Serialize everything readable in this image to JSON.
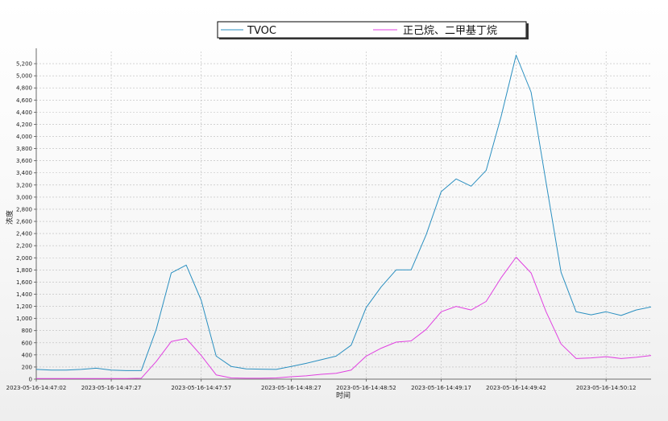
{
  "chart_data": {
    "type": "line",
    "xlabel": "时间",
    "ylabel": "浓度",
    "ylim": [
      0,
      5400
    ],
    "y_ticks": [
      0,
      200,
      400,
      600,
      800,
      1000,
      1200,
      1400,
      1600,
      1800,
      2000,
      2200,
      2400,
      2600,
      2800,
      3000,
      3200,
      3400,
      3600,
      3800,
      4000,
      4200,
      4400,
      4600,
      4800,
      5000,
      5200
    ],
    "y_tick_labels": [
      "0",
      "200",
      "400",
      "600",
      "800",
      "1,000",
      "1,200",
      "1,400",
      "1,600",
      "1,800",
      "2,000",
      "2,200",
      "2,400",
      "2,600",
      "2,800",
      "3,000",
      "3,200",
      "3,400",
      "3,600",
      "3,800",
      "4,000",
      "4,200",
      "4,400",
      "4,600",
      "4,800",
      "5,000",
      "5,200"
    ],
    "x_ticks": [
      "2023-05-16-14:47:02",
      "2023-05-16-14:47:27",
      "2023-05-16-14:47:57",
      "2023-05-16-14:48:27",
      "2023-05-16-14:48:52",
      "2023-05-16-14:49:17",
      "2023-05-16-14:49:42",
      "2023-05-16-14:50:12"
    ],
    "x_tick_seconds": [
      2,
      27,
      57,
      87,
      112,
      137,
      162,
      192
    ],
    "grid": true,
    "legend_position": "top",
    "x": [
      0,
      5,
      10,
      15,
      20,
      25,
      30,
      35,
      40,
      45,
      50,
      55,
      60,
      65,
      70,
      75,
      80,
      85,
      90,
      95,
      100,
      105,
      110,
      115,
      120,
      125,
      130,
      135,
      140,
      145,
      150,
      155,
      160,
      165,
      170,
      175,
      180,
      185,
      190,
      195,
      200,
      205
    ],
    "series": [
      {
        "name": "TVOC",
        "color": "#2a8fc0",
        "values": [
          160,
          150,
          150,
          160,
          180,
          150,
          140,
          140,
          820,
          1750,
          1880,
          1300,
          380,
          210,
          170,
          165,
          160,
          210,
          260,
          320,
          380,
          560,
          1180,
          1520,
          1800,
          1800,
          2380,
          3090,
          3300,
          3180,
          3440,
          4330,
          5340,
          4730,
          3240,
          1760,
          1110,
          1060,
          1110,
          1050,
          1140,
          1190
        ]
      },
      {
        "name": "正己烷、二甲基丁烷",
        "color": "#e040e0",
        "values": [
          10,
          10,
          10,
          10,
          10,
          10,
          10,
          15,
          290,
          620,
          670,
          390,
          70,
          20,
          15,
          15,
          20,
          40,
          55,
          80,
          95,
          150,
          380,
          510,
          610,
          630,
          820,
          1110,
          1200,
          1140,
          1280,
          1670,
          2010,
          1750,
          1110,
          580,
          340,
          350,
          370,
          340,
          360,
          390
        ]
      }
    ]
  }
}
